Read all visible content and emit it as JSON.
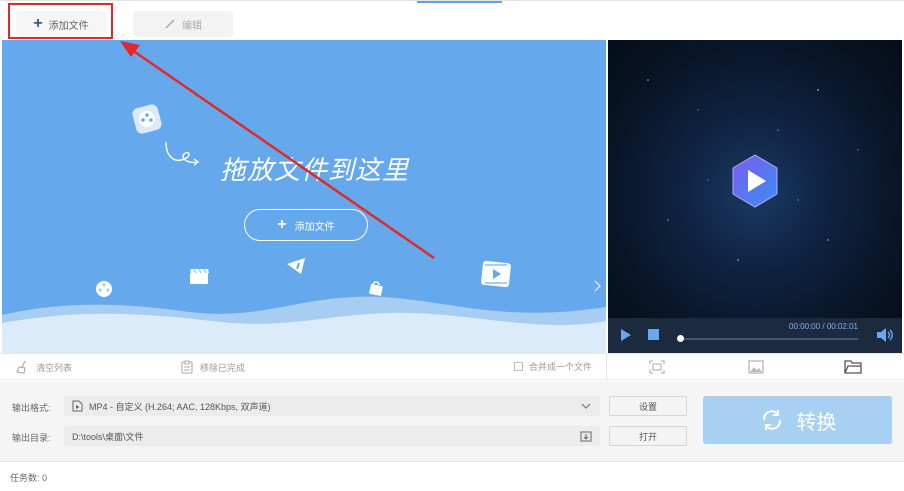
{
  "toolbar": {
    "add_file_label": "添加文件",
    "edit_label": "编辑"
  },
  "dropzone": {
    "title": "拖放文件到这里",
    "add_file_label": "添加文件"
  },
  "player": {
    "time": "00:00:00 / 00:02:01",
    "progress": 0.0
  },
  "actions": {
    "clear_list": "清空列表",
    "remove_done": "移除已完成",
    "merge_label": "合并成一个文件"
  },
  "output": {
    "format_label": "输出格式:",
    "format_value": "MP4 - 自定义 (H.264; AAC, 128Kbps, 双声道)",
    "dir_label": "输出目录:",
    "dir_value": "D:\\tools\\桌面\\文件",
    "settings_button": "设置",
    "open_button": "打开",
    "convert_button": "转换"
  },
  "status": {
    "task_count": "任务数: 0"
  },
  "colors": {
    "drop_blue": "#65a8ec",
    "convert_blue": "#a8d0f2",
    "annotation_red": "#e02a2a"
  }
}
